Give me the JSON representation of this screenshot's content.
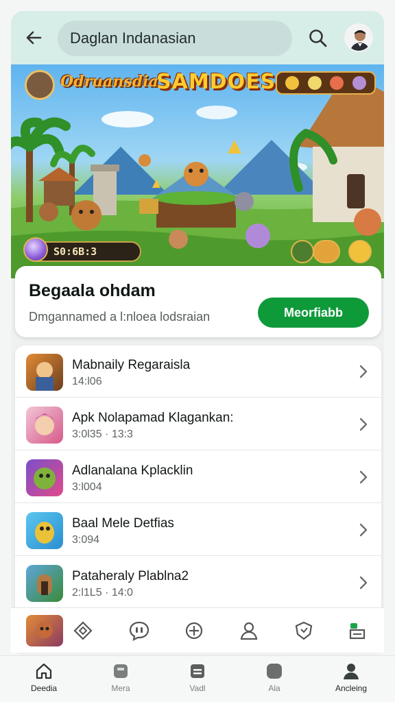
{
  "header": {
    "back_icon": "arrow-left-icon",
    "search_query": "Daglan Indanasian",
    "search_icon": "search-icon",
    "avatar_icon": "profile-avatar"
  },
  "banner": {
    "logo_left": "Odruansdia",
    "logo_right": "SAMDOES",
    "score_text": "S0:6B:3"
  },
  "feature": {
    "title": "Begaala ohdam",
    "subtitle": "Dmgannamed a l:nloea lodsraian",
    "action_label": "Meorfiabb"
  },
  "list": {
    "items": [
      {
        "title": "Mabnaily Regaraisla",
        "meta": "14:l06",
        "thumb": "game-thumb-adventurer"
      },
      {
        "title": "Apk Nolapamad Klagankan:",
        "meta": "3:0l35 · 13:3",
        "thumb": "game-thumb-pink-hero"
      },
      {
        "title": "Adlanalana Kplacklin",
        "meta": "3:l004",
        "thumb": "game-thumb-green-creature"
      },
      {
        "title": "Baal Mele Detfias",
        "meta": "3:094",
        "thumb": "game-thumb-yellow-monster"
      },
      {
        "title": "Pataheraly Plablna2",
        "meta": "2:l1L5 · 14:0",
        "thumb": "game-thumb-shrine"
      }
    ],
    "chevron_icon": "chevron-right-icon"
  },
  "action_strip": {
    "icons": [
      "diamond-icon",
      "chat-bubble-icon",
      "crosshair-icon",
      "person-icon",
      "shield-icon",
      "store-icon"
    ]
  },
  "bottom_nav": {
    "items": [
      {
        "label": "Deedia",
        "icon": "home-icon",
        "active": true
      },
      {
        "label": "Mera",
        "icon": "apps-icon",
        "active": false
      },
      {
        "label": "Vadl",
        "icon": "list-icon",
        "active": false
      },
      {
        "label": "Ala",
        "icon": "square-icon",
        "active": false
      },
      {
        "label": "Ancleing",
        "icon": "account-icon",
        "active": true
      }
    ]
  },
  "colors": {
    "header_bg": "#d7ede8",
    "primary_green": "#0f9a3a",
    "page_bg": "#f4f6f5"
  }
}
